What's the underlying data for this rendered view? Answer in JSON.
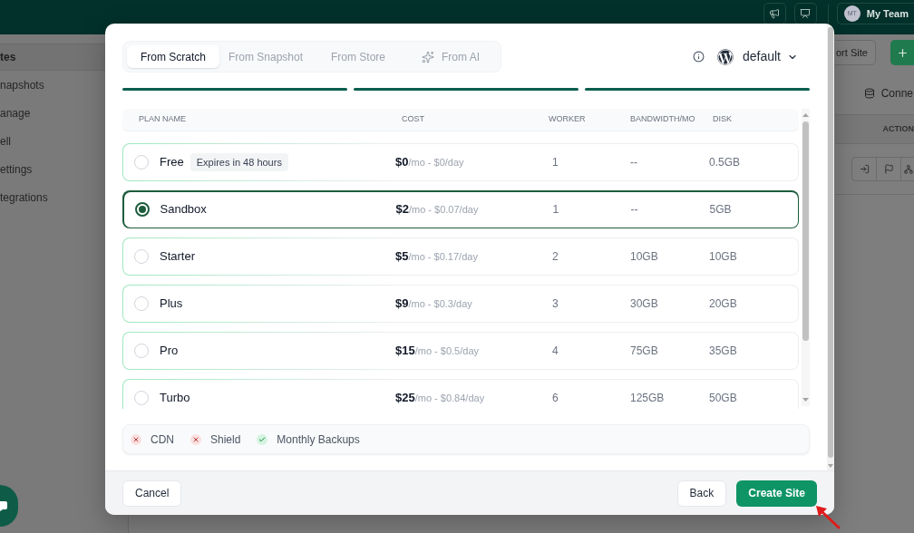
{
  "top_bar": {
    "team": {
      "initials": "MT",
      "name": "My Team"
    }
  },
  "sidebar": {
    "items": [
      {
        "label": "tes",
        "selected": true
      },
      {
        "label": "napshots",
        "selected": false
      },
      {
        "label": "anage",
        "selected": false
      },
      {
        "label": "ell",
        "selected": false
      },
      {
        "label": "ettings",
        "selected": false
      },
      {
        "label": "tegrations",
        "selected": false
      }
    ]
  },
  "page": {
    "header_button": "ort Site",
    "connect_label": "Conne",
    "table_header": "ACTION"
  },
  "dialog": {
    "tabs": [
      {
        "label": "From Scratch",
        "selected": true,
        "kind": "plain"
      },
      {
        "label": "From Snapshot",
        "selected": false,
        "kind": "plain"
      },
      {
        "label": "From Store",
        "selected": false,
        "kind": "plain"
      },
      {
        "label": "From AI",
        "selected": false,
        "kind": "ai"
      }
    ],
    "platform": "default",
    "steps": [
      {
        "done": true
      },
      {
        "done": true
      },
      {
        "done": true
      }
    ],
    "table": {
      "columns": [
        "PLAN NAME",
        "COST",
        "WORKER",
        "BANDWIDTH/MO",
        "DISK"
      ],
      "rows": [
        {
          "name": "Free",
          "badge": "Expires in 48 hours",
          "cost": "**$0**/mo - $0/day",
          "worker": "1",
          "bandwidth": "--",
          "disk": "0.5GB",
          "selected": false
        },
        {
          "name": "Sandbox",
          "cost": "**$2**/mo - $0.07/day",
          "worker": "1",
          "bandwidth": "--",
          "disk": "5GB",
          "selected": true
        },
        {
          "name": "Starter",
          "cost": "**$5**/mo - $0.17/day",
          "worker": "2",
          "bandwidth": "10GB",
          "disk": "10GB",
          "selected": false
        },
        {
          "name": "Plus",
          "cost": "**$9**/mo - $0.3/day",
          "worker": "3",
          "bandwidth": "30GB",
          "disk": "20GB",
          "selected": false
        },
        {
          "name": "Pro",
          "cost": "**$15**/mo - $0.5/day",
          "worker": "4",
          "bandwidth": "75GB",
          "disk": "35GB",
          "selected": false
        },
        {
          "name": "Turbo",
          "cost": "**$25**/mo - $0.84/day",
          "worker": "6",
          "bandwidth": "125GB",
          "disk": "50GB",
          "selected": false
        }
      ]
    },
    "features": [
      {
        "label": "CDN",
        "included": false
      },
      {
        "label": "Shield",
        "included": false
      },
      {
        "label": "Monthly Backups",
        "included": true
      }
    ],
    "footer": {
      "cancel": "Cancel",
      "back": "Back",
      "create": "Create Site"
    }
  }
}
